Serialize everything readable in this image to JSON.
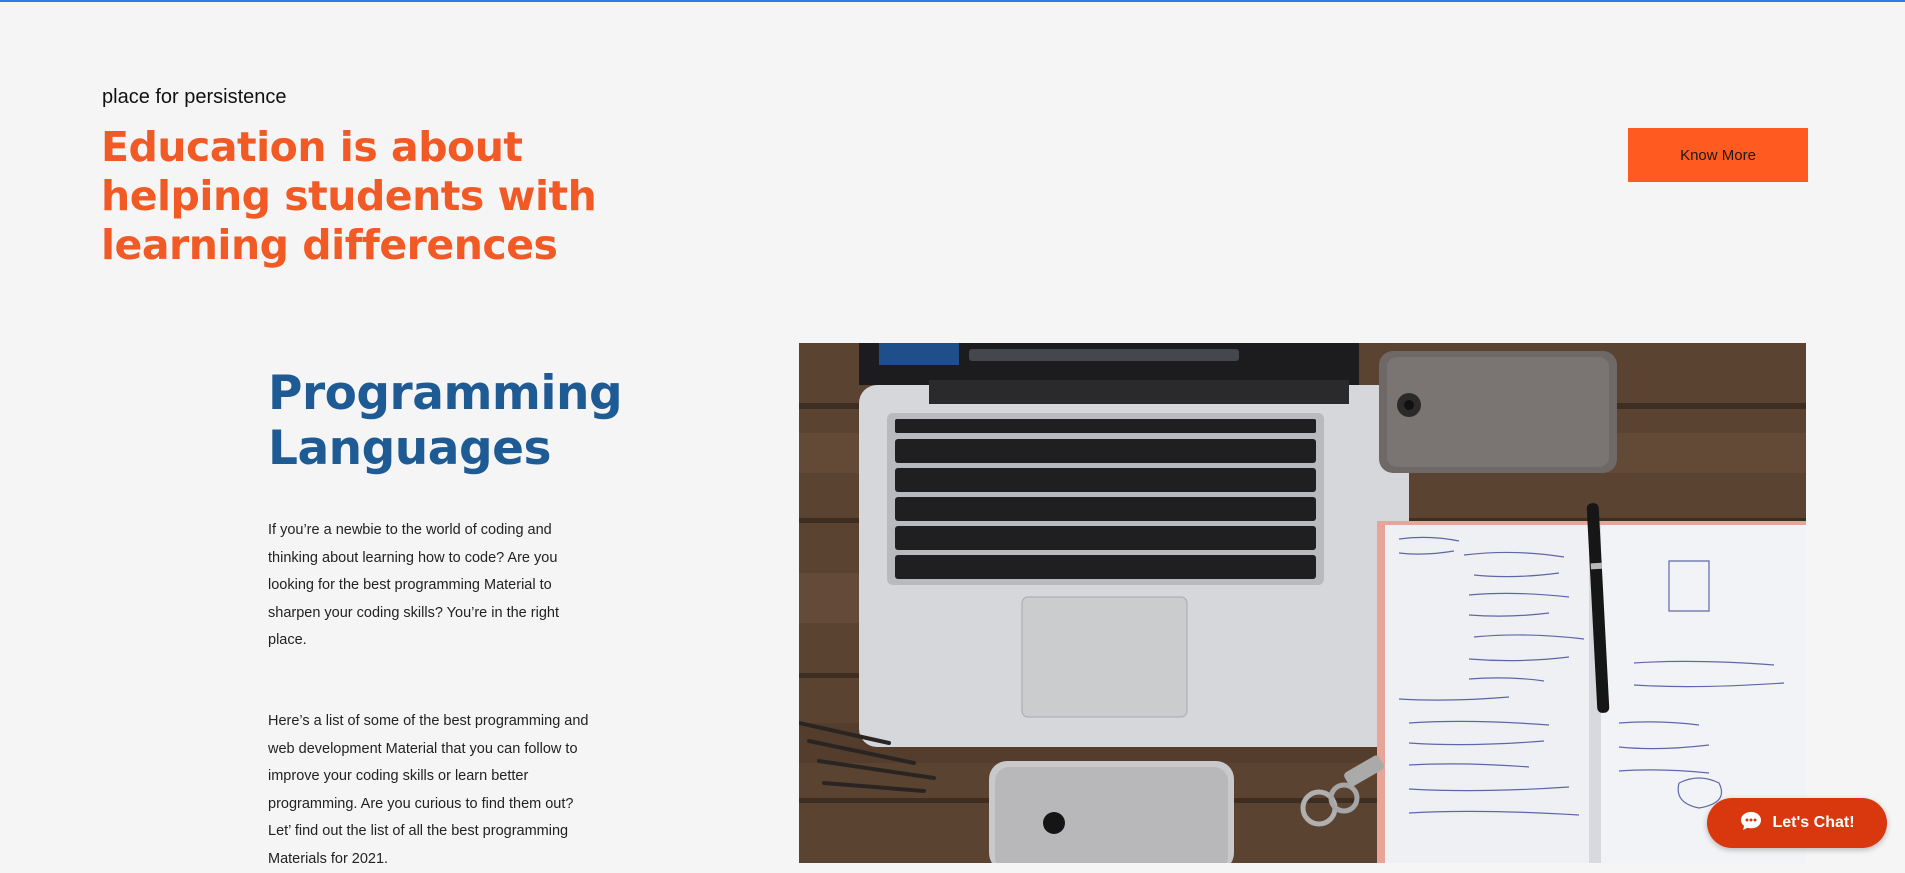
{
  "hero": {
    "tagline": "place for persistence",
    "title": "Education is about helping students with learning differences",
    "cta_label": "Know More"
  },
  "section": {
    "title": "Programming Languages",
    "paragraph1": "If you’re a newbie to the world of coding and thinking about learning how to code? Are you looking for the best programming Material to sharpen your coding skills? You’re in the right place.",
    "paragraph2": "Here’s a list of some of the best programming and web development Material that you can follow to improve your coding skills or learn better programming. Are you curious to find them out? Let’ find out the list of all the best programming Materials for 2021."
  },
  "chat": {
    "label": "Let's Chat!",
    "icon": "chat-bubble-icon"
  },
  "colors": {
    "accent": "#f15a24",
    "button": "#ff5a1f",
    "heading": "#1e5b94",
    "chat": "#d9380e",
    "background": "#f5f5f5"
  }
}
